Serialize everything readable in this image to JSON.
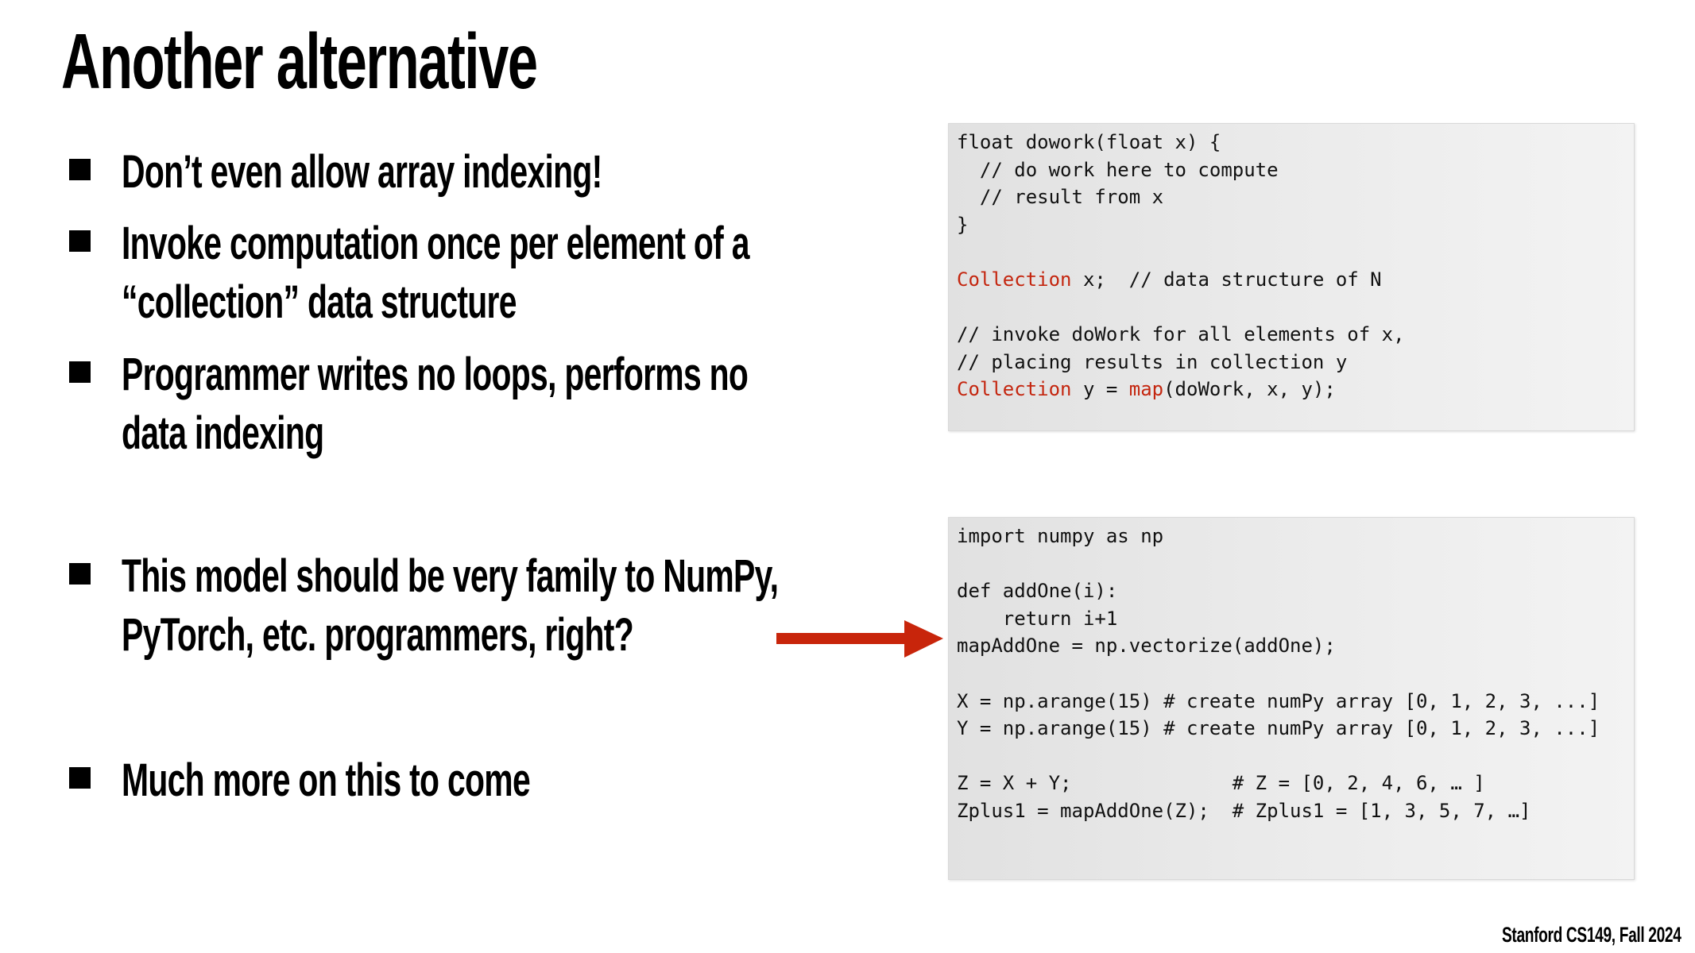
{
  "slide": {
    "title": "Another alternative",
    "footer": "Stanford CS149, Fall 2024",
    "accent_color": "#c8250b",
    "bullets": [
      {
        "lines": [
          "Don’t even allow array indexing!"
        ]
      },
      {
        "lines": [
          "Invoke computation once per element of a",
          "“collection” data structure"
        ]
      },
      {
        "lines": [
          "Programmer writes no loops, performs no",
          "data indexing"
        ]
      },
      {
        "lines": [
          "This model should be very family to NumPy,",
          "PyTorch, etc. programmers, right?"
        ]
      },
      {
        "lines": [
          "Much more on this to come"
        ]
      }
    ]
  },
  "code_blocks": [
    {
      "lines": [
        [
          {
            "t": "float dowork(float x) {"
          }
        ],
        [
          {
            "t": "  // do work here to compute"
          }
        ],
        [
          {
            "t": "  // result from x"
          }
        ],
        [
          {
            "t": "}"
          }
        ],
        [
          {
            "t": ""
          }
        ],
        [
          {
            "t": "Collection",
            "kw": true
          },
          {
            "t": " x;  // data structure of N"
          }
        ],
        [
          {
            "t": ""
          }
        ],
        [
          {
            "t": "// invoke doWork for all elements of x,"
          }
        ],
        [
          {
            "t": "// placing results in collection y"
          }
        ],
        [
          {
            "t": "Collection",
            "kw": true
          },
          {
            "t": " y = "
          },
          {
            "t": "map",
            "kw": true
          },
          {
            "t": "(doWork, x, y);"
          }
        ]
      ]
    },
    {
      "lines": [
        [
          {
            "t": "import numpy as np"
          }
        ],
        [
          {
            "t": ""
          }
        ],
        [
          {
            "t": "def addOne(i):"
          }
        ],
        [
          {
            "t": "    return i+1"
          }
        ],
        [
          {
            "t": "mapAddOne = np.vectorize(addOne);"
          }
        ],
        [
          {
            "t": ""
          }
        ],
        [
          {
            "t": "X = np.arange(15) # create numPy array [0, 1, 2, 3, ...]"
          }
        ],
        [
          {
            "t": "Y = np.arange(15) # create numPy array [0, 1, 2, 3, ...]"
          }
        ],
        [
          {
            "t": ""
          }
        ],
        [
          {
            "t": "Z = X + Y;              # Z = [0, 2, 4, 6, … ]"
          }
        ],
        [
          {
            "t": "Zplus1 = mapAddOne(Z);  # Zplus1 = [1, 3, 5, 7, …]"
          }
        ]
      ]
    }
  ]
}
